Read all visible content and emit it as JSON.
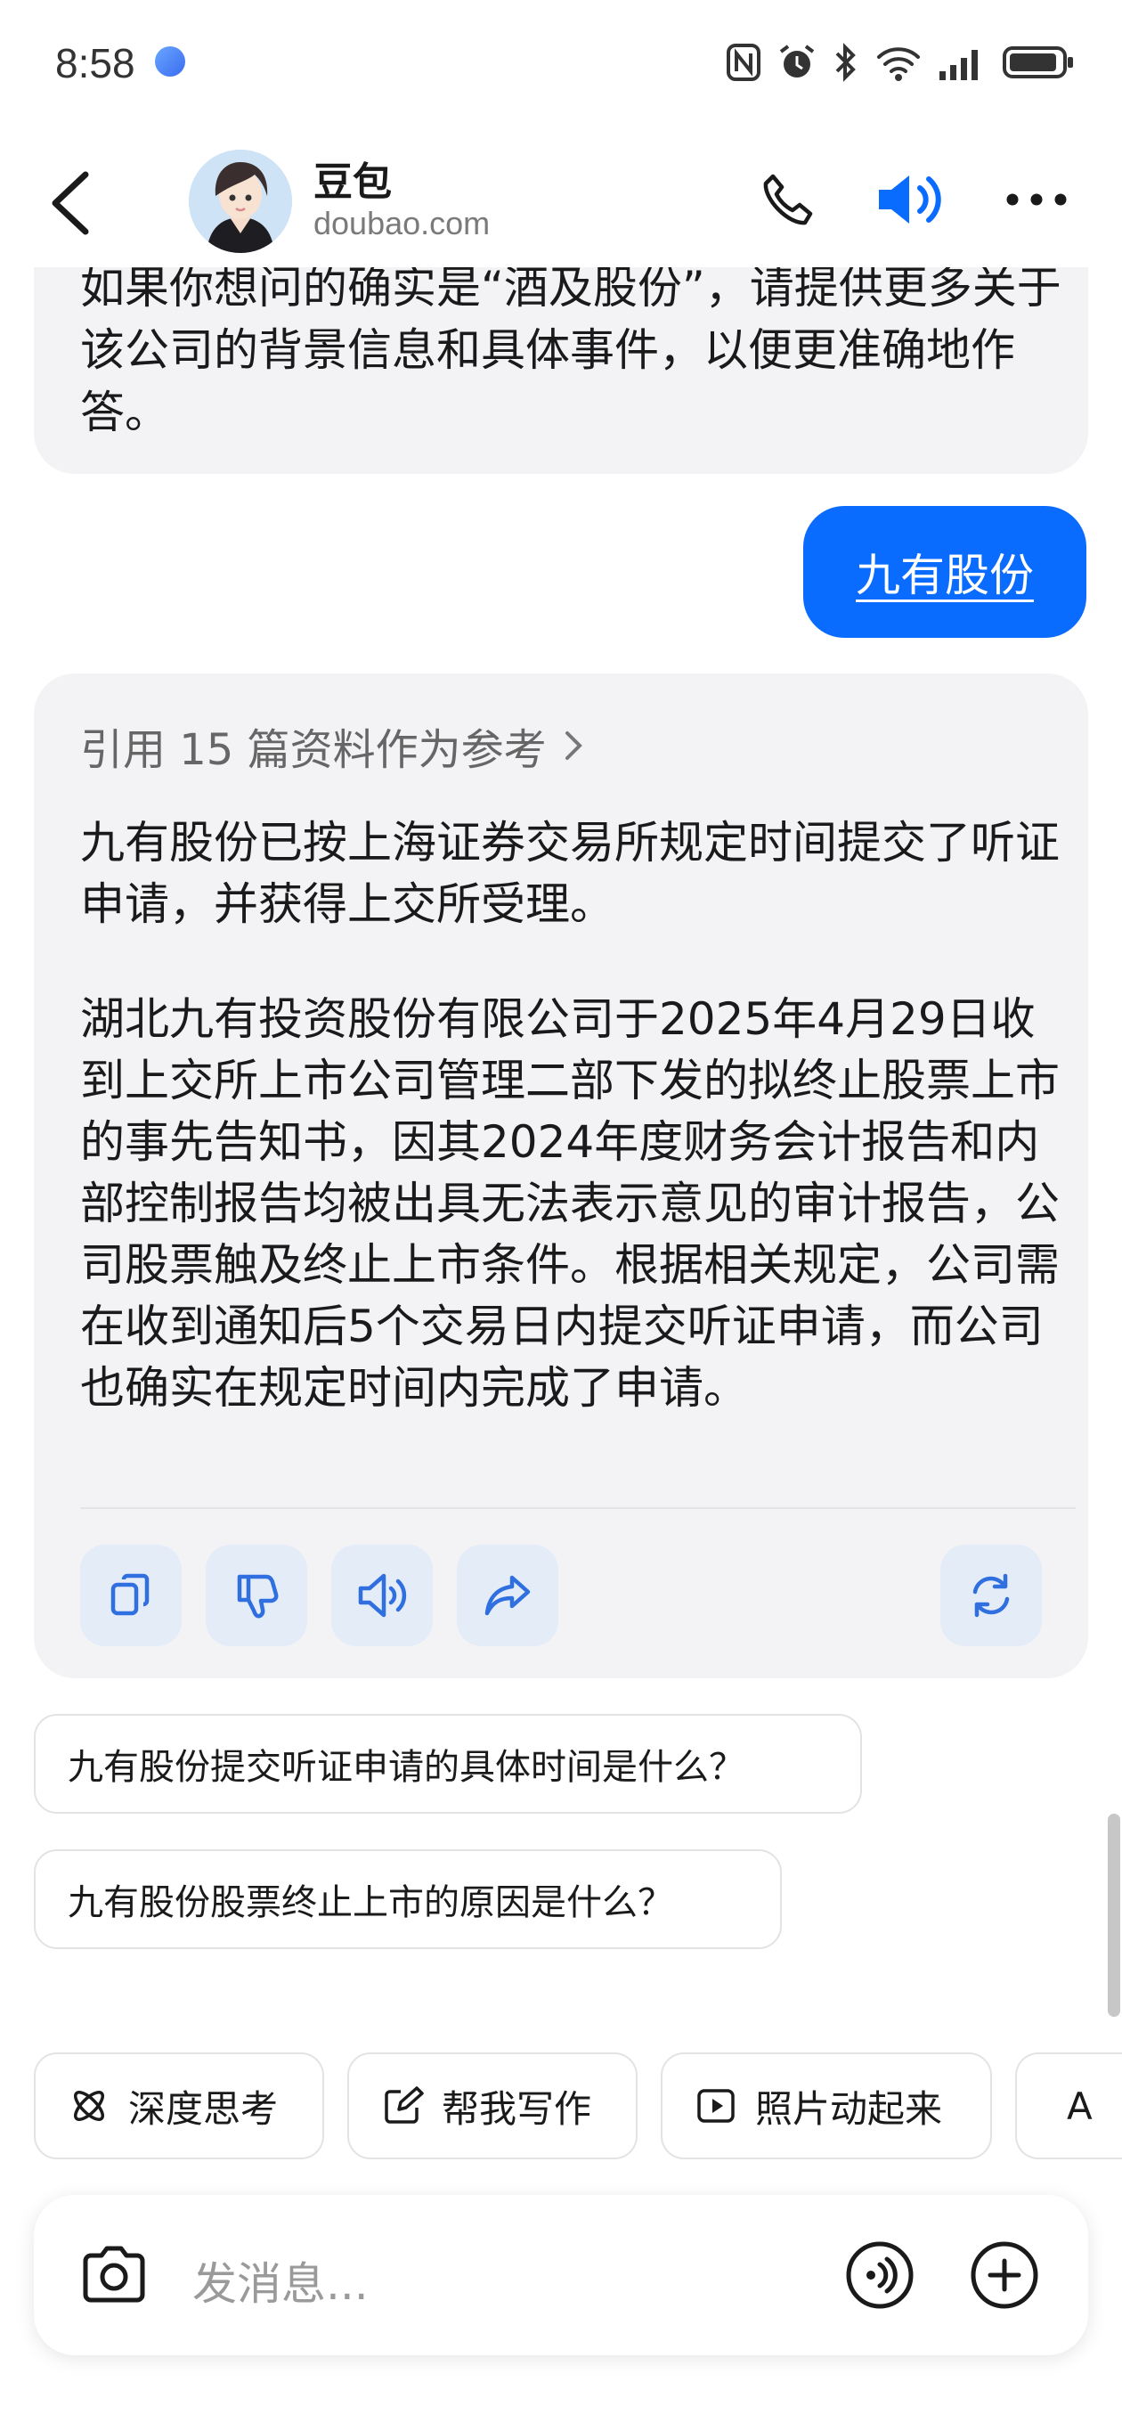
{
  "status_bar": {
    "time": "8:58"
  },
  "header": {
    "name": "豆包",
    "domain": "doubao.com"
  },
  "chat": {
    "previous_reply": "如果你想问的确实是“酒及股份”，请提供更多关于该公司的背景信息和具体事件，以便更准确地作答。",
    "user_message": "九有股份",
    "answer": {
      "reference": "引用 15 篇资料作为参考",
      "paragraph_1": "九有股份已按上海证券交易所规定时间提交了听证申请，并获得上交所受理。",
      "paragraph_2": "湖北九有投资股份有限公司于2025年4月29日收到上交所上市公司管理二部下发的拟终止股票上市的事先告知书，因其2024年度财务会计报告和内部控制报告均被出具无法表示意见的审计报告，公司股票触及终止上市条件。根据相关规定，公司需在收到通知后5个交易日内提交听证申请，而公司也确实在规定时间内完成了申请。",
      "actions": [
        "copy-icon",
        "thumbs-down-icon",
        "speaker-icon",
        "share-icon",
        "regenerate-icon"
      ]
    },
    "suggestions": [
      "九有股份提交听证申请的具体时间是什么？",
      "九有股份股票终止上市的原因是什么？"
    ]
  },
  "quick_actions": [
    "深度思考",
    "帮我写作",
    "照片动起来",
    "A"
  ],
  "input": {
    "placeholder": "发消息..."
  },
  "colors": {
    "accent": "#0a6cff",
    "bubble_gray": "#f3f3f6",
    "action_bg": "#e4ecf8"
  }
}
